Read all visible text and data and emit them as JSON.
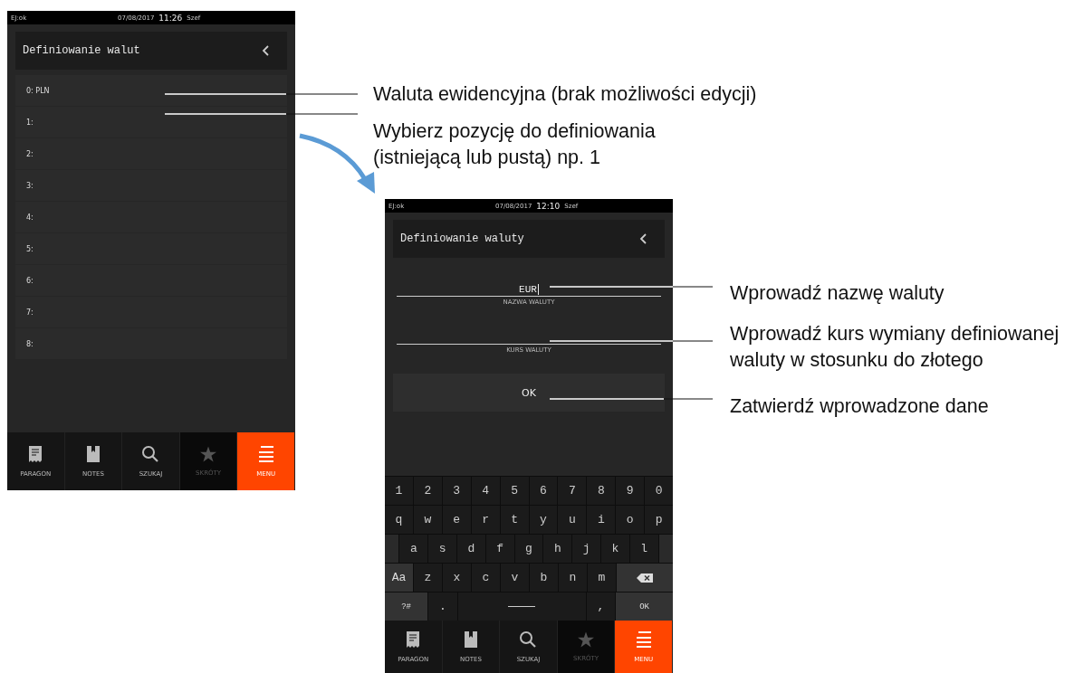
{
  "screens": [
    {
      "status": {
        "left": "EJ:ok",
        "date": "07/08/2017",
        "time": "11:26",
        "user": "Szef"
      },
      "header": {
        "title": "Definiowanie walut"
      },
      "list": [
        "0: PLN",
        "1:",
        "2:",
        "3:",
        "4:",
        "5:",
        "6:",
        "7:",
        "8:"
      ],
      "nav": [
        {
          "label": "PARAGON",
          "selected": false,
          "disabled": false
        },
        {
          "label": "NOTES",
          "selected": false,
          "disabled": false
        },
        {
          "label": "SZUKAJ",
          "selected": false,
          "disabled": false
        },
        {
          "label": "SKRÓTY",
          "selected": false,
          "disabled": true
        },
        {
          "label": "MENU",
          "selected": true,
          "disabled": false
        }
      ]
    },
    {
      "status": {
        "left": "EJ:ok",
        "date": "07/08/2017",
        "time": "12:10",
        "user": "Szef"
      },
      "header": {
        "title": "Definiowanie waluty"
      },
      "fields": [
        {
          "value": "EUR",
          "label": "NAZWA WALUTY",
          "focused": true
        },
        {
          "label": "KURS WALUTY",
          "focused": false
        }
      ],
      "button": "OK",
      "keyboard": [
        [
          {
            "kind": "char",
            "label": "1"
          },
          {
            "kind": "char",
            "label": "2"
          },
          {
            "kind": "char",
            "label": "3"
          },
          {
            "kind": "char",
            "label": "4"
          },
          {
            "kind": "char",
            "label": "5"
          },
          {
            "kind": "char",
            "label": "6"
          },
          {
            "kind": "char",
            "label": "7"
          },
          {
            "kind": "char",
            "label": "8"
          },
          {
            "kind": "char",
            "label": "9"
          },
          {
            "kind": "char",
            "label": "0"
          }
        ],
        [
          {
            "kind": "char",
            "label": "q"
          },
          {
            "kind": "char",
            "label": "w"
          },
          {
            "kind": "char",
            "label": "e"
          },
          {
            "kind": "char",
            "label": "r"
          },
          {
            "kind": "char",
            "label": "t"
          },
          {
            "kind": "char",
            "label": "y"
          },
          {
            "kind": "char",
            "label": "u"
          },
          {
            "kind": "char",
            "label": "i"
          },
          {
            "kind": "char",
            "label": "o"
          },
          {
            "kind": "char",
            "label": "p"
          }
        ],
        [
          {
            "kind": "filler"
          },
          {
            "kind": "char",
            "label": "a"
          },
          {
            "kind": "char",
            "label": "s"
          },
          {
            "kind": "char",
            "label": "d"
          },
          {
            "kind": "char",
            "label": "f"
          },
          {
            "kind": "char",
            "label": "g"
          },
          {
            "kind": "char",
            "label": "h"
          },
          {
            "kind": "char",
            "label": "j"
          },
          {
            "kind": "char",
            "label": "k"
          },
          {
            "kind": "char",
            "label": "l"
          },
          {
            "kind": "filler"
          }
        ],
        [
          {
            "kind": "shift",
            "label": "Aa"
          },
          {
            "kind": "char",
            "label": "z"
          },
          {
            "kind": "char",
            "label": "x"
          },
          {
            "kind": "char",
            "label": "c"
          },
          {
            "kind": "char",
            "label": "v"
          },
          {
            "kind": "char",
            "label": "b"
          },
          {
            "kind": "char",
            "label": "n"
          },
          {
            "kind": "char",
            "label": "m"
          },
          {
            "kind": "backspace"
          }
        ],
        [
          {
            "kind": "symbols",
            "label": "?#"
          },
          {
            "kind": "char",
            "label": "."
          },
          {
            "kind": "space"
          },
          {
            "kind": "char",
            "label": ","
          },
          {
            "kind": "enter",
            "label": "OK"
          }
        ]
      ],
      "nav": [
        {
          "label": "PARAGON",
          "selected": false,
          "disabled": false
        },
        {
          "label": "NOTES",
          "selected": false,
          "disabled": false
        },
        {
          "label": "SZUKAJ",
          "selected": false,
          "disabled": false
        },
        {
          "label": "SKRÓTY",
          "selected": false,
          "disabled": true
        },
        {
          "label": "MENU",
          "selected": true,
          "disabled": false
        }
      ]
    }
  ],
  "annotations": [
    {
      "lines": [
        "Waluta ewidencyjna (brak możliwości edycji)"
      ]
    },
    {
      "lines": [
        "Wybierz pozycję do definiowania",
        "(istniejącą lub pustą) np. 1"
      ]
    },
    {
      "lines": [
        "Wprowadź nazwę waluty"
      ]
    },
    {
      "lines": [
        "Wprowadź kurs wymiany definiowanej",
        "waluty w stosunku do złotego"
      ]
    },
    {
      "lines": [
        "Zatwierdź wprowadzone dane"
      ]
    }
  ]
}
